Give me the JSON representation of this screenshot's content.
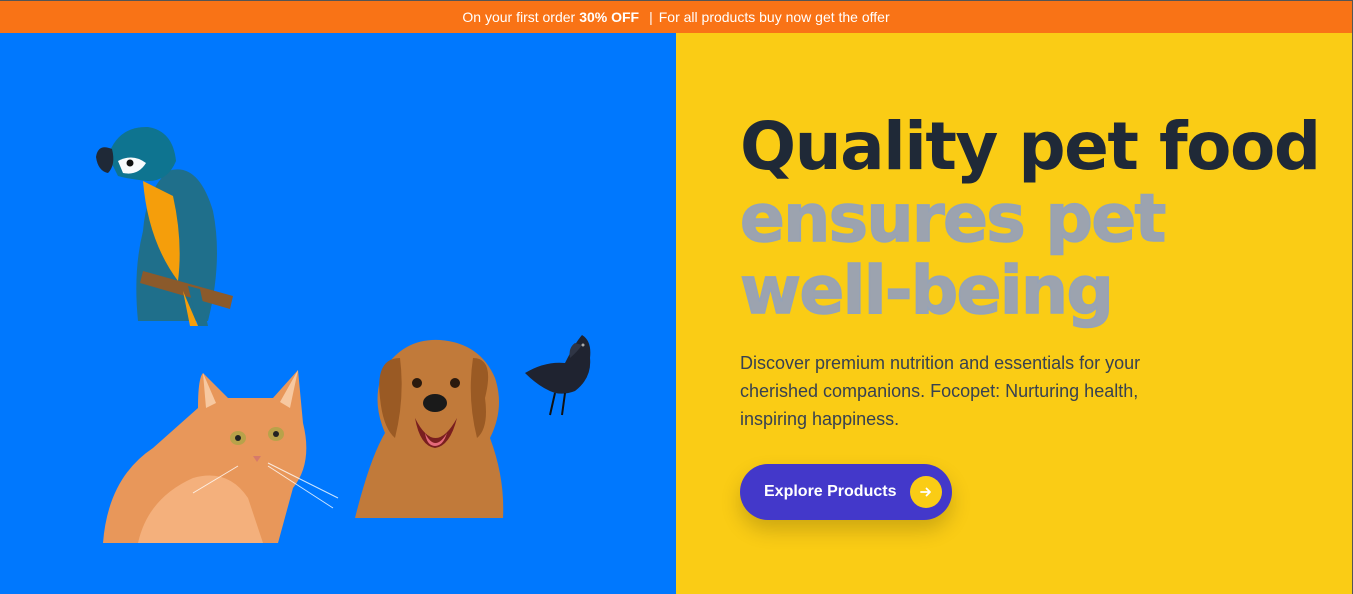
{
  "promo": {
    "prefix": "On your first order",
    "highlight": "30% OFF",
    "separator": "|",
    "suffix": "For all products buy now get the offer"
  },
  "hero": {
    "headline_dark": "Quality pet food",
    "headline_muted": "ensures pet well-being",
    "description": "Discover premium nutrition and essentials for your cherished companions. Focopet: Nurturing health, inspiring happiness.",
    "cta_label": "Explore Products",
    "cta_icon": "arrow-right-icon"
  },
  "colors": {
    "promo_bg": "#f97316",
    "left_bg": "#0078fe",
    "right_bg": "#facc15",
    "cta_bg": "#4338ca",
    "headline": "#1f2937",
    "headline_muted": "#9ca3af"
  },
  "images": [
    "parrot",
    "cat",
    "dog",
    "crow"
  ]
}
